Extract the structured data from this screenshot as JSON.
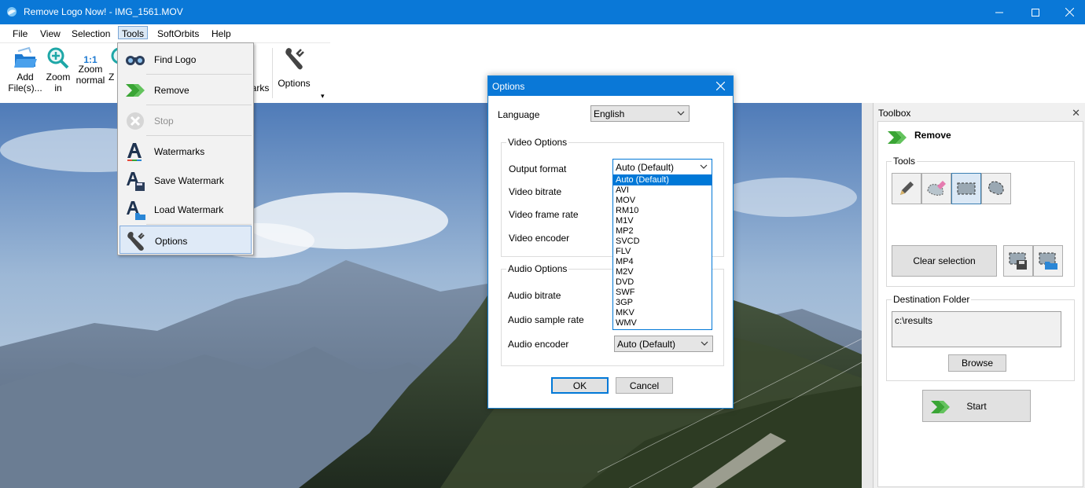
{
  "window": {
    "title": "Remove Logo Now! - IMG_1561.MOV"
  },
  "menubar": [
    "File",
    "View",
    "Selection",
    "Tools",
    "SoftOrbits",
    "Help"
  ],
  "toolbar": {
    "add_files": [
      "Add",
      "File(s)..."
    ],
    "zoom_in": [
      "Zoom",
      "in"
    ],
    "zoom_normal": [
      "Zoom",
      "normal"
    ],
    "zoom_normal_icon_text": "1:1",
    "zoom_out_partial": "Z",
    "watermarks_partial": "arks",
    "options": "Options",
    "overflow": "▾"
  },
  "tools_menu": {
    "items": [
      {
        "label": "Find Logo",
        "icon": "binoculars-icon"
      },
      {
        "label": "Remove",
        "icon": "green-arrow-icon"
      },
      {
        "label": "Stop",
        "icon": "stop-icon",
        "disabled": true
      },
      {
        "label": "Watermarks",
        "icon": "watermark-icon"
      },
      {
        "label": "Save Watermark",
        "icon": "save-watermark-icon"
      },
      {
        "label": "Load Watermark",
        "icon": "load-watermark-icon"
      },
      {
        "label": "Options",
        "icon": "wrench-icon",
        "highlighted": true
      }
    ]
  },
  "options_dialog": {
    "title": "Options",
    "language_label": "Language",
    "language_value": "English",
    "video_group": "Video Options",
    "output_format_label": "Output format",
    "output_format_value": "Auto (Default)",
    "video_bitrate_label": "Video bitrate",
    "video_frame_rate_label": "Video frame rate",
    "video_encoder_label": "Video encoder",
    "audio_group": "Audio Options",
    "audio_bitrate_label": "Audio bitrate",
    "audio_sample_rate_label": "Audio sample rate",
    "audio_encoder_label": "Audio encoder",
    "audio_encoder_value": "Auto (Default)",
    "ok": "OK",
    "cancel": "Cancel",
    "format_options": [
      "Auto (Default)",
      "AVI",
      "MOV",
      "RM10",
      "M1V",
      "MP2",
      "SVCD",
      "FLV",
      "MP4",
      "M2V",
      "DVD",
      "SWF",
      "3GP",
      "MKV",
      "WMV"
    ],
    "selected_format_index": 0
  },
  "toolbox": {
    "title": "Toolbox",
    "close": "✕",
    "remove_heading": "Remove",
    "tools_group": "Tools",
    "clear_selection": "Clear selection",
    "destination_group": "Destination Folder",
    "destination_value": "c:\\results",
    "browse": "Browse",
    "start": "Start"
  },
  "colors": {
    "accent": "#0a78d7",
    "selection": "#0078d7",
    "green": "#3aa535"
  }
}
